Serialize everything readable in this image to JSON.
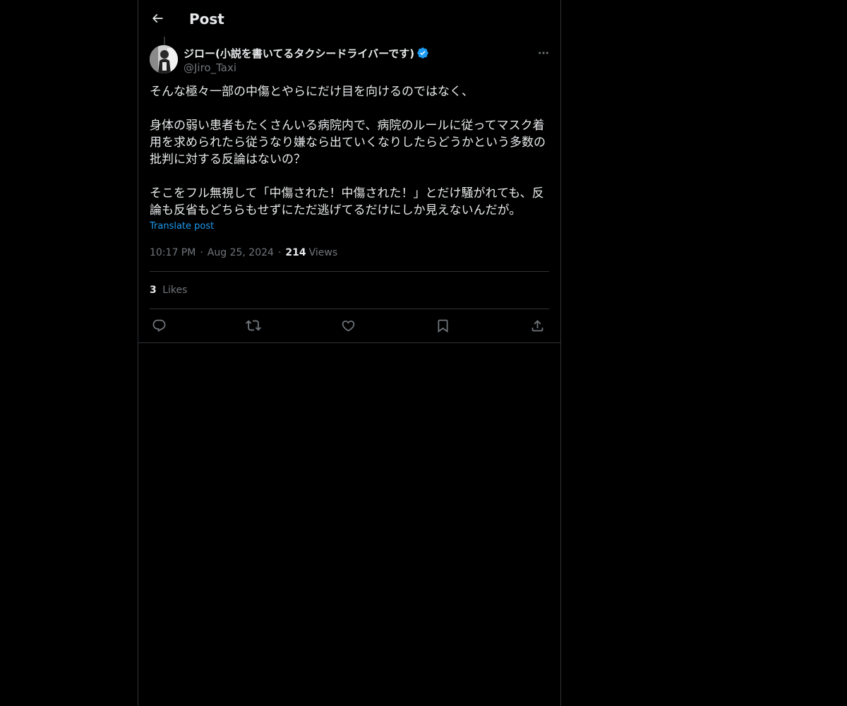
{
  "header": {
    "title": "Post"
  },
  "author": {
    "display_name": "ジロー(小説を書いてるタクシードライバーです)",
    "handle": "@Jiro_Taxi",
    "verified": true
  },
  "post": {
    "paragraphs": [
      "そんな極々一部の中傷とやらにだけ目を向けるのではなく、",
      "身体の弱い患者もたくさんいる病院内で、病院のルールに従ってマスク着用を求められたら従うなり嫌なら出ていくなりしたらどうかという多数の批判に対する反論はないの？",
      "そこをフル無視して「中傷された！中傷された！」とだけ騒がれても、反論も反省もどちらもせずにただ逃げてるだけにしか見えないんだが。"
    ],
    "translate_label": "Translate post",
    "time": "10:17 PM",
    "date": "Aug 25, 2024",
    "views_count": "214",
    "views_label": "Views",
    "likes_count": "3",
    "likes_label": "Likes"
  },
  "icons": {
    "back": "arrow-left-icon",
    "more": "more-horizontal-icon",
    "verified": "verified-badge-icon",
    "reply": "reply-icon",
    "repost": "repost-icon",
    "like": "heart-icon",
    "bookmark": "bookmark-icon",
    "share": "share-icon"
  },
  "colors": {
    "background": "#000000",
    "text": "#e7e9ea",
    "secondary": "#71767b",
    "accent": "#1d9bf0",
    "border": "#2f3336"
  }
}
